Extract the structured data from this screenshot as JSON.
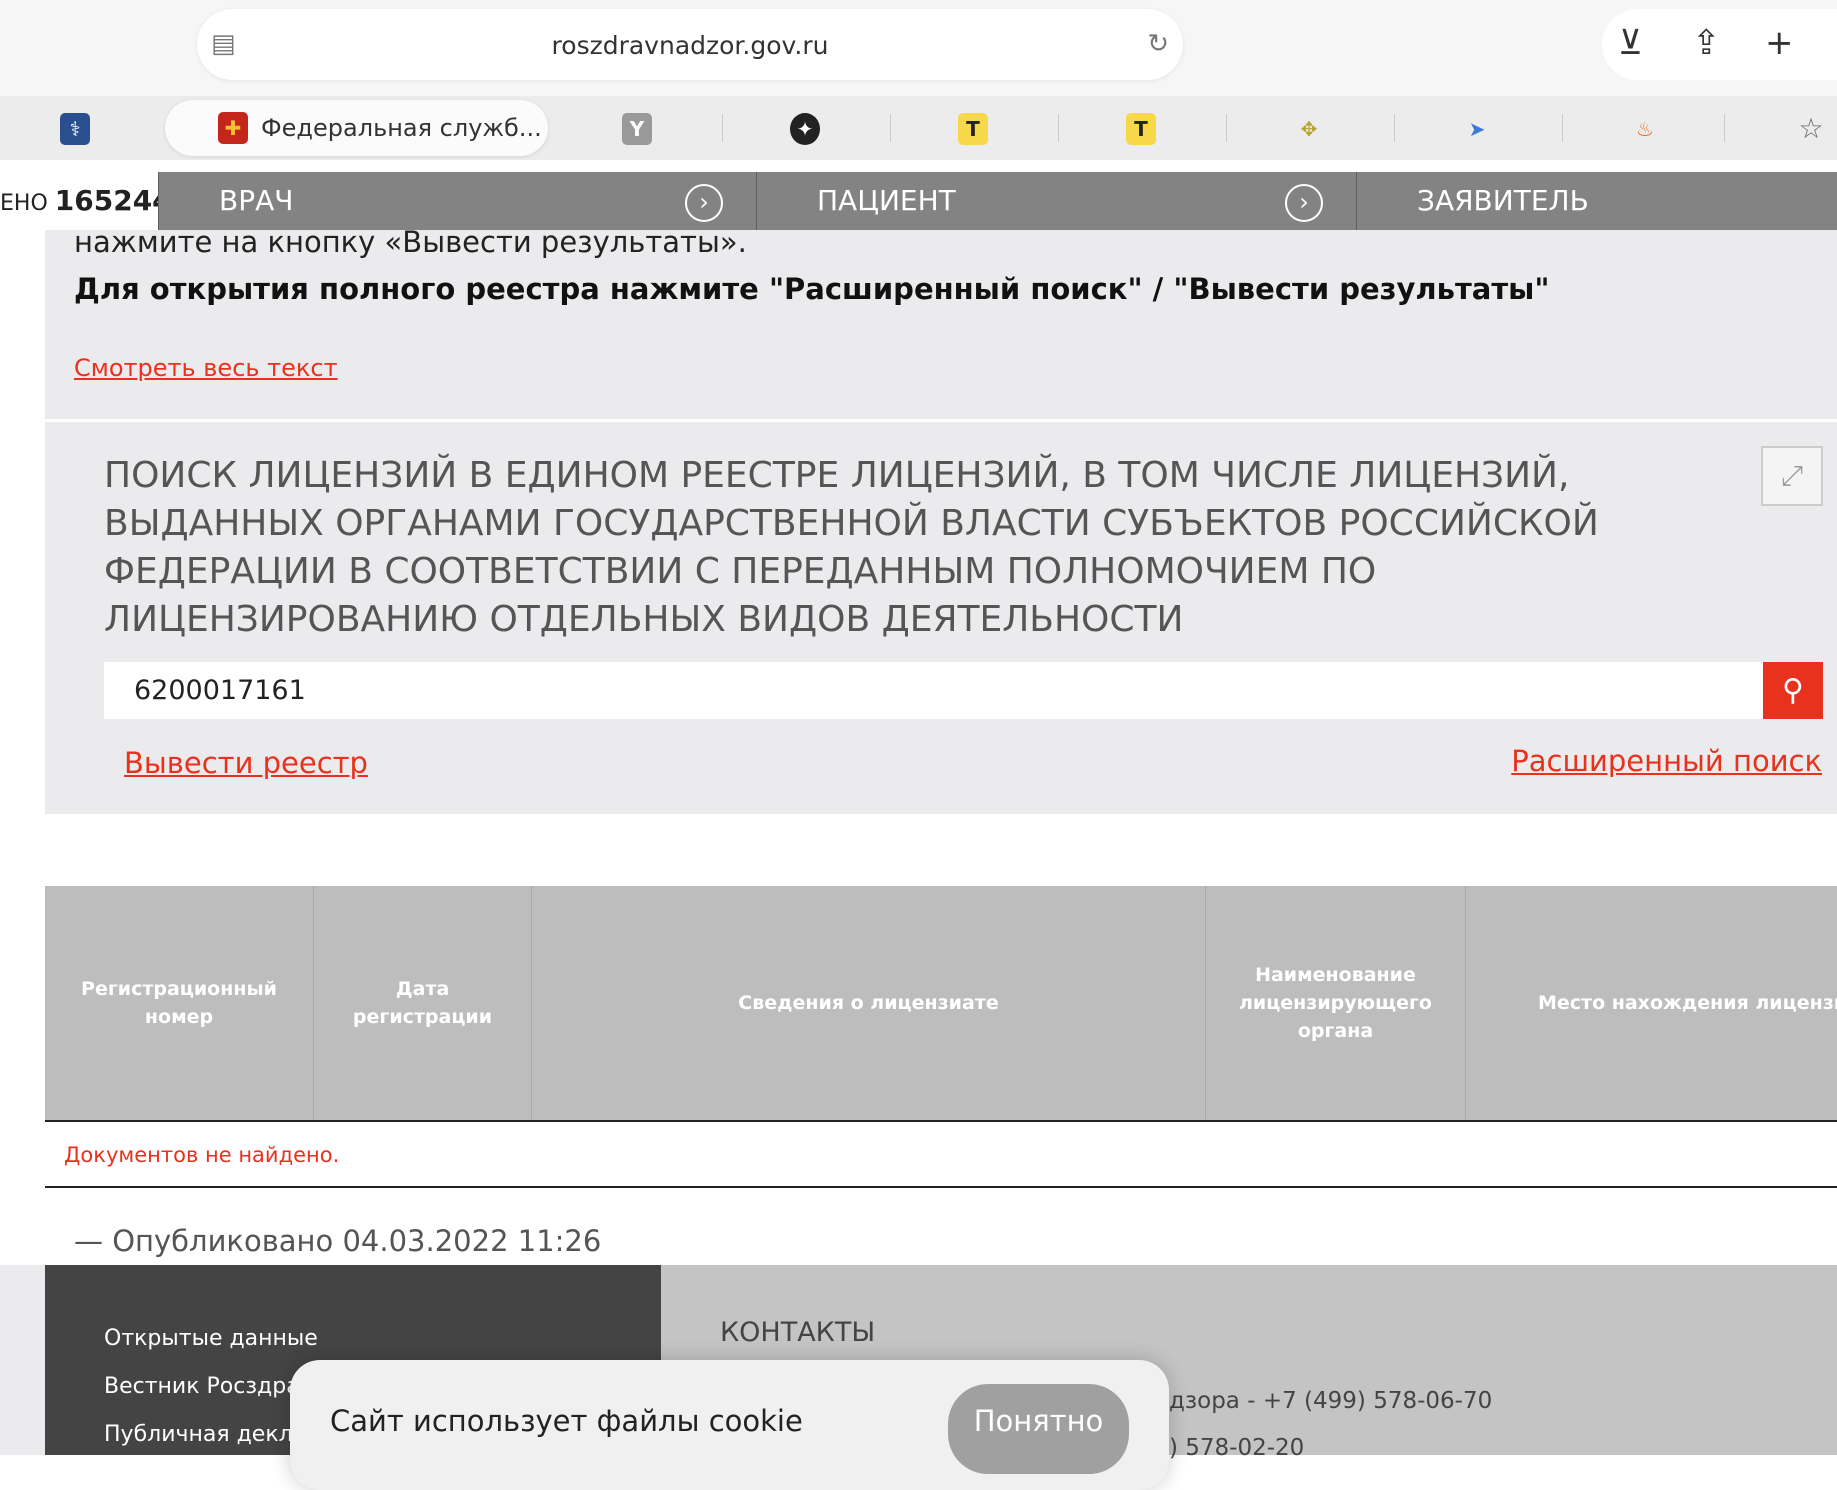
{
  "browser": {
    "url": "roszdravnadzor.gov.ru",
    "active_tab": "Федеральная служб...",
    "icons": [
      "page-icon",
      "reload-icon",
      "download-icon",
      "share-icon",
      "new-tab-icon",
      "bookmark-star-icon"
    ]
  },
  "nav": {
    "counter_prefix": "ЕНО",
    "counter_value": "165244",
    "items": [
      "ВРАЧ",
      "ПАЦИЕНТ",
      "ЗАЯВИТЕЛЬ"
    ]
  },
  "intro": {
    "line1": "нажмите на кнопку «Вывести результаты».",
    "line2": "Для открытия полного реестра нажмите \"Расширенный поиск\" / \"Вывести результаты\"",
    "more_link": "Смотреть весь текст"
  },
  "search": {
    "title": "ПОИСК ЛИЦЕНЗИЙ В ЕДИНОМ РЕЕСТРЕ ЛИЦЕНЗИЙ, В ТОМ ЧИСЛЕ ЛИЦЕНЗИЙ, ВЫДАННЫХ ОРГАНАМИ ГОСУДАРСТВЕННОЙ ВЛАСТИ СУБЪЕКТОВ РОССИЙСКОЙ ФЕДЕРАЦИИ В СООТВЕТСТВИИ С ПЕРЕДАННЫМ ПОЛНОМОЧИЕМ ПО ЛИЦЕНЗИРОВАНИЮ ОТДЕЛЬНЫХ ВИДОВ ДЕЯТЕЛЬНОСТИ",
    "query": "6200017161",
    "registry_link": "Вывести реестр",
    "advanced_link": "Расширенный поиск"
  },
  "table": {
    "headers": [
      "Регистрационный\nномер",
      "Дата\nрегистрации",
      "Сведения о лицензиате",
      "Наименование\nлицензирующего\nоргана",
      "Место нахождения лицензиата"
    ],
    "empty": "Документов не найдено."
  },
  "published": "— Опубликовано 04.03.2022 11:26",
  "footer": {
    "links": [
      "Открытые данные",
      "Вестник Росздравнадзора",
      "Публичная декларация"
    ],
    "contacts_title": "КОНТАКТЫ",
    "phone1": "дзора - +7 (499) 578-06-70",
    "phone2": ") 578-02-20"
  },
  "cookie": {
    "text": "Сайт использует файлы cookie",
    "button": "Понятно"
  },
  "colors": {
    "accent": "#e8321e",
    "nav": "#828382"
  }
}
